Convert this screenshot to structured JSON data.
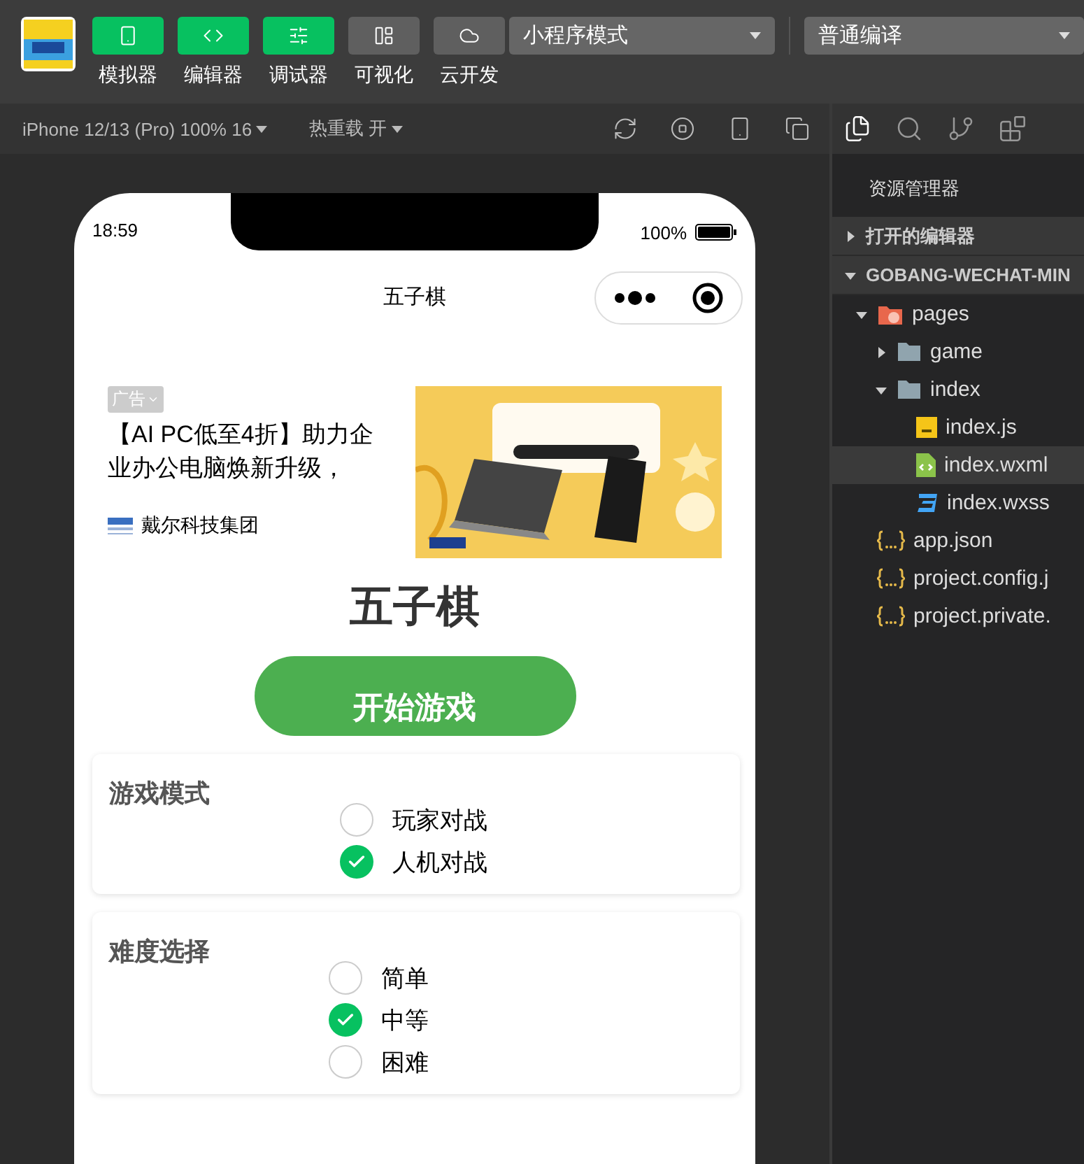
{
  "toolbar": {
    "tools": [
      {
        "kind": "simulator",
        "label": "模拟器",
        "on": true
      },
      {
        "kind": "editor",
        "label": "编辑器",
        "on": true
      },
      {
        "kind": "debugger",
        "label": "调试器",
        "on": true
      },
      {
        "kind": "visual",
        "label": "可视化",
        "on": false
      },
      {
        "kind": "cloud",
        "label": "云开发",
        "on": false
      }
    ],
    "mode_select": "小程序模式",
    "compile_select": "普通编译"
  },
  "simulator_bar": {
    "device": "iPhone 12/13 (Pro) 100% 16",
    "hot_reload": "热重载 开"
  },
  "phone": {
    "time": "18:59",
    "battery": "100%",
    "nav_title": "五子棋",
    "ad": {
      "tag": "广告",
      "text": "【AI PC低至4折】助力企业办公电脑焕新升级，",
      "brand": "戴尔科技集团"
    },
    "title": "五子棋",
    "start_button": "开始游戏",
    "sections": [
      {
        "title": "游戏模式",
        "options": [
          {
            "label": "玩家对战",
            "selected": false
          },
          {
            "label": "人机对战",
            "selected": true
          }
        ]
      },
      {
        "title": "难度选择",
        "options": [
          {
            "label": "简单",
            "selected": false
          },
          {
            "label": "中等",
            "selected": true
          },
          {
            "label": "困难",
            "selected": false
          }
        ]
      }
    ]
  },
  "explorer": {
    "title": "资源管理器",
    "sections": [
      {
        "label": "打开的编辑器",
        "expanded": false
      },
      {
        "label": "GOBANG-WECHAT-MIN",
        "expanded": true
      }
    ],
    "tree": [
      {
        "kind": "pages",
        "label": "pages",
        "expanded": true,
        "children": [
          {
            "kind": "folder",
            "label": "game",
            "expanded": false
          },
          {
            "kind": "folder",
            "label": "index",
            "expanded": true,
            "children": [
              {
                "kind": "js",
                "label": "index.js",
                "selected": false
              },
              {
                "kind": "wxml",
                "label": "index.wxml",
                "selected": true
              },
              {
                "kind": "wxss",
                "label": "index.wxss",
                "selected": false
              }
            ]
          }
        ]
      },
      {
        "kind": "json",
        "label": "app.json",
        "selected": false
      },
      {
        "kind": "json",
        "label": "project.config.j",
        "selected": false
      },
      {
        "kind": "json",
        "label": "project.private.",
        "selected": false
      }
    ]
  }
}
